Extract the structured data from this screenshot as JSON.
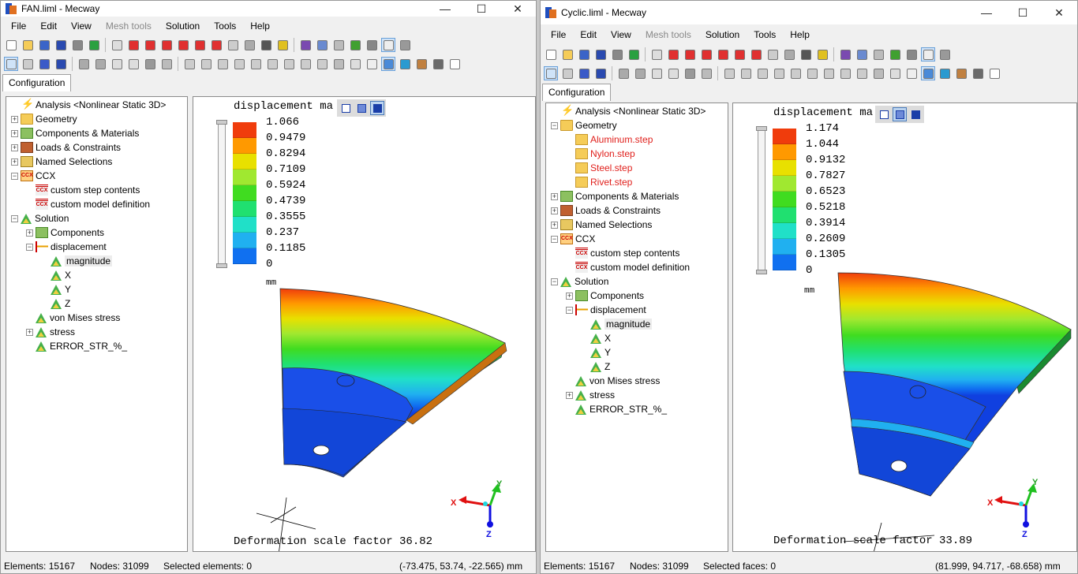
{
  "windows": [
    {
      "title": "FAN.liml - Mecway",
      "menu": [
        "File",
        "Edit",
        "View",
        "Mesh tools",
        "Solution",
        "Tools",
        "Help"
      ],
      "tab": "Configuration",
      "tree": [
        {
          "label": "Analysis <Nonlinear Static 3D>",
          "icon": "lightning-icon"
        },
        {
          "label": "Geometry",
          "icon": "folder-icon"
        },
        {
          "label": "Components & Materials",
          "icon": "components-icon"
        },
        {
          "label": "Loads & Constraints",
          "icon": "loads-icon"
        },
        {
          "label": "Named Selections",
          "icon": "named-selections-icon"
        },
        {
          "label": "CCX",
          "icon": "ccx-icon"
        },
        {
          "label": "custom step contents",
          "icon": "ccx-file-icon"
        },
        {
          "label": "custom model definition",
          "icon": "ccx-file-icon"
        },
        {
          "label": "Solution",
          "icon": "solution-icon"
        },
        {
          "label": "Components",
          "icon": "components-icon"
        },
        {
          "label": "displacement",
          "icon": "displacement-icon"
        },
        {
          "label": "magnitude",
          "icon": "result-icon"
        },
        {
          "label": "X",
          "icon": "result-icon"
        },
        {
          "label": "Y",
          "icon": "result-icon"
        },
        {
          "label": "Z",
          "icon": "result-icon"
        },
        {
          "label": "von Mises stress",
          "icon": "result-icon"
        },
        {
          "label": "stress",
          "icon": "result-icon"
        },
        {
          "label": "ERROR_STR_%_",
          "icon": "result-icon"
        }
      ],
      "legend": {
        "title": "displacement ma",
        "values": [
          "1.066",
          "0.9479",
          "0.8294",
          "0.7109",
          "0.5924",
          "0.4739",
          "0.3555",
          "0.237",
          "0.1185",
          "0"
        ],
        "unit": "mm"
      },
      "deformation": "Deformation scale factor 36.82",
      "axes": {
        "x": "X",
        "y": "Y",
        "z": "Z"
      },
      "status": {
        "elements": "Elements: 15167",
        "nodes": "Nodes: 31099",
        "selected": "Selected elements: 0",
        "coords": "(-73.475, 53.74, -22.565) mm"
      }
    },
    {
      "title": "Cyclic.liml - Mecway",
      "menu": [
        "File",
        "Edit",
        "View",
        "Mesh tools",
        "Solution",
        "Tools",
        "Help"
      ],
      "tab": "Configuration",
      "tree": [
        {
          "label": "Analysis <Nonlinear Static 3D>",
          "icon": "lightning-icon"
        },
        {
          "label": "Geometry",
          "icon": "folder-icon"
        },
        {
          "label": "Aluminum.step",
          "icon": "step-file-icon"
        },
        {
          "label": "Nylon.step",
          "icon": "step-file-icon"
        },
        {
          "label": "Steel.step",
          "icon": "step-file-icon"
        },
        {
          "label": "Rivet.step",
          "icon": "step-file-icon"
        },
        {
          "label": "Components & Materials",
          "icon": "components-icon"
        },
        {
          "label": "Loads & Constraints",
          "icon": "loads-icon"
        },
        {
          "label": "Named Selections",
          "icon": "named-selections-icon"
        },
        {
          "label": "CCX",
          "icon": "ccx-icon"
        },
        {
          "label": "custom step contents",
          "icon": "ccx-file-icon"
        },
        {
          "label": "custom model definition",
          "icon": "ccx-file-icon"
        },
        {
          "label": "Solution",
          "icon": "solution-icon"
        },
        {
          "label": "Components",
          "icon": "components-icon"
        },
        {
          "label": "displacement",
          "icon": "displacement-icon"
        },
        {
          "label": "magnitude",
          "icon": "result-icon"
        },
        {
          "label": "X",
          "icon": "result-icon"
        },
        {
          "label": "Y",
          "icon": "result-icon"
        },
        {
          "label": "Z",
          "icon": "result-icon"
        },
        {
          "label": "von Mises stress",
          "icon": "result-icon"
        },
        {
          "label": "stress",
          "icon": "result-icon"
        },
        {
          "label": "ERROR_STR_%_",
          "icon": "result-icon"
        }
      ],
      "legend": {
        "title": "displacement ma",
        "values": [
          "1.174",
          "1.044",
          "0.9132",
          "0.7827",
          "0.6523",
          "0.5218",
          "0.3914",
          "0.2609",
          "0.1305",
          "0"
        ],
        "unit": "mm"
      },
      "deformation": "Deformation scale factor 33.89",
      "axes": {
        "x": "X",
        "y": "Y",
        "z": "Z"
      },
      "status": {
        "elements": "Elements: 15167",
        "nodes": "Nodes: 31099",
        "selected": "Selected faces: 0",
        "coords": "(81.999, 94.717, -68.658) mm"
      }
    }
  ],
  "legend_colors": [
    "#f03c0c",
    "#ff9900",
    "#e8e000",
    "#a0e830",
    "#40dc20",
    "#20e070",
    "#20e0c8",
    "#20b0f0",
    "#1070f0",
    "#1040e0"
  ],
  "window_buttons": {
    "minimize": "—",
    "maximize": "☐",
    "close": "✕"
  }
}
